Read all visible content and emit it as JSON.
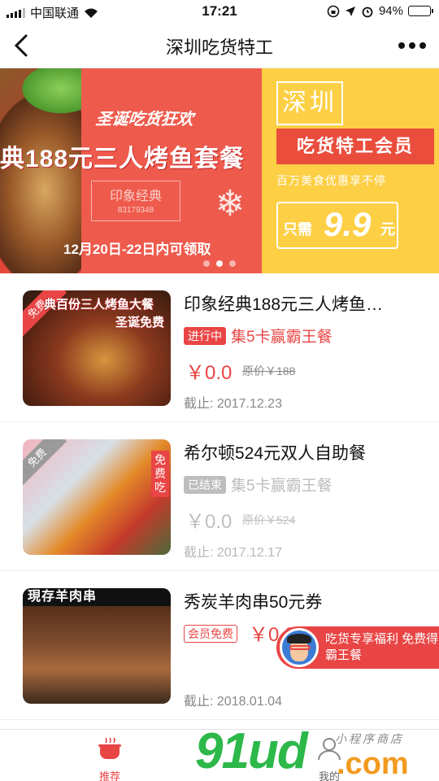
{
  "status_bar": {
    "carrier": "中国联通",
    "time": "17:21",
    "battery_percent_text": "94%",
    "battery_level": 0.94
  },
  "nav": {
    "title": "深圳吃货特工",
    "back_icon": "chevron-left-icon",
    "more_icon": "more-dots-icon"
  },
  "banner": {
    "left": {
      "subtitle": "圣诞吃货狂欢",
      "headline": "典188元三人烤鱼套餐",
      "logo_text": "印象经典",
      "logo_sub": "83179348",
      "date": "12月20日-22日内可领取"
    },
    "right": {
      "brand": "深圳",
      "card": "吃货特工会员",
      "slogan": "百万美食优惠享不停",
      "price_prefix": "只需",
      "price_value": "9.9",
      "price_suffix": "元"
    },
    "dots": 3,
    "active_dot": 1
  },
  "items": [
    {
      "title": "印象经典188元三人烤鱼…",
      "ribbon": "免费",
      "thumb_caption": "典百份三人烤鱼大餐",
      "thumb_caption2": "圣诞免费",
      "tag": "进行中",
      "subtitle": "集5卡赢霸王餐",
      "price": "￥0.0",
      "original_price": "原价￥188",
      "deadline": "截止: 2017.12.23"
    },
    {
      "title": "希尔顿524元双人自助餐",
      "ribbon": "免费",
      "thumb_caption": "免费吃",
      "tag": "已结束",
      "subtitle": "集5卡赢霸王餐",
      "price": "￥0.0",
      "original_price": "原价￥524",
      "deadline": "截止: 2017.12.17"
    },
    {
      "title": "秀炭羊肉串50元券",
      "thumb_caption": "現存羊肉串",
      "tag": "会员免费",
      "price": "￥0.0",
      "deadline": "截止: 2018.01.04"
    }
  ],
  "promo": {
    "text": "吃货专享福利 免费得霸王餐"
  },
  "tabbar": {
    "home_label": "推荐",
    "mine_label": "我的"
  },
  "watermark": {
    "logo": "91ud",
    "domain": ".com",
    "small": "小程序商店"
  },
  "colors": {
    "accent": "#e94545",
    "banner_left": "#ee5a4c",
    "banner_right": "#fdcf45",
    "watermark_green": "#2db84a",
    "watermark_orange": "#f29a20"
  }
}
